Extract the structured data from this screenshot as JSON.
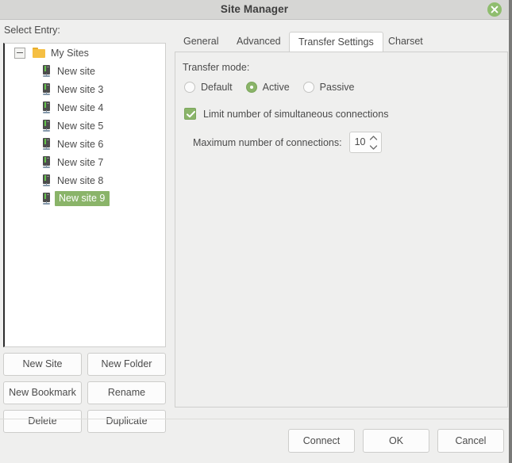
{
  "window": {
    "title": "Site Manager",
    "close_icon": "close-icon"
  },
  "colors": {
    "accent_green": "#8ab469",
    "close_button_green": "#8fbd6e",
    "titlebar": "#d6d6d4",
    "dialog_bg": "#efefee",
    "tree_bg": "#ffffff",
    "folder_yellow": "#f5bf43",
    "server_led_green": "#63c24b",
    "text": "#4b4b4b"
  },
  "sidebar": {
    "label": "Select Entry:",
    "tree": {
      "root": {
        "label": "My Sites",
        "icon": "folder-icon",
        "expander": "collapse-minus-icon",
        "expanded": true
      },
      "items": [
        {
          "label": "New site",
          "icon": "server-icon",
          "selected": false
        },
        {
          "label": "New site 3",
          "icon": "server-icon",
          "selected": false
        },
        {
          "label": "New site 4",
          "icon": "server-icon",
          "selected": false
        },
        {
          "label": "New site 5",
          "icon": "server-icon",
          "selected": false
        },
        {
          "label": "New site 6",
          "icon": "server-icon",
          "selected": false
        },
        {
          "label": "New site 7",
          "icon": "server-icon",
          "selected": false
        },
        {
          "label": "New site 8",
          "icon": "server-icon",
          "selected": false
        },
        {
          "label": "New site 9",
          "icon": "server-icon",
          "selected": true
        }
      ]
    },
    "buttons": [
      {
        "label": "New Site"
      },
      {
        "label": "New Folder"
      },
      {
        "label": "New Bookmark"
      },
      {
        "label": "Rename"
      },
      {
        "label": "Delete"
      },
      {
        "label": "Duplicate"
      }
    ]
  },
  "main": {
    "tabs": [
      {
        "label": "General",
        "active": false
      },
      {
        "label": "Advanced",
        "active": false
      },
      {
        "label": "Transfer Settings",
        "active": true
      },
      {
        "label": "Charset",
        "active": false
      }
    ],
    "transfer_settings": {
      "transfer_mode_label": "Transfer mode:",
      "modes": [
        {
          "label": "Default",
          "checked": false
        },
        {
          "label": "Active",
          "checked": true
        },
        {
          "label": "Passive",
          "checked": false
        }
      ],
      "limit_connections": {
        "label": "Limit number of simultaneous connections",
        "checked": true
      },
      "max_connections": {
        "label": "Maximum number of connections:",
        "value": "10"
      }
    }
  },
  "footer": {
    "buttons": [
      {
        "label": "Connect"
      },
      {
        "label": "OK"
      },
      {
        "label": "Cancel"
      }
    ]
  }
}
